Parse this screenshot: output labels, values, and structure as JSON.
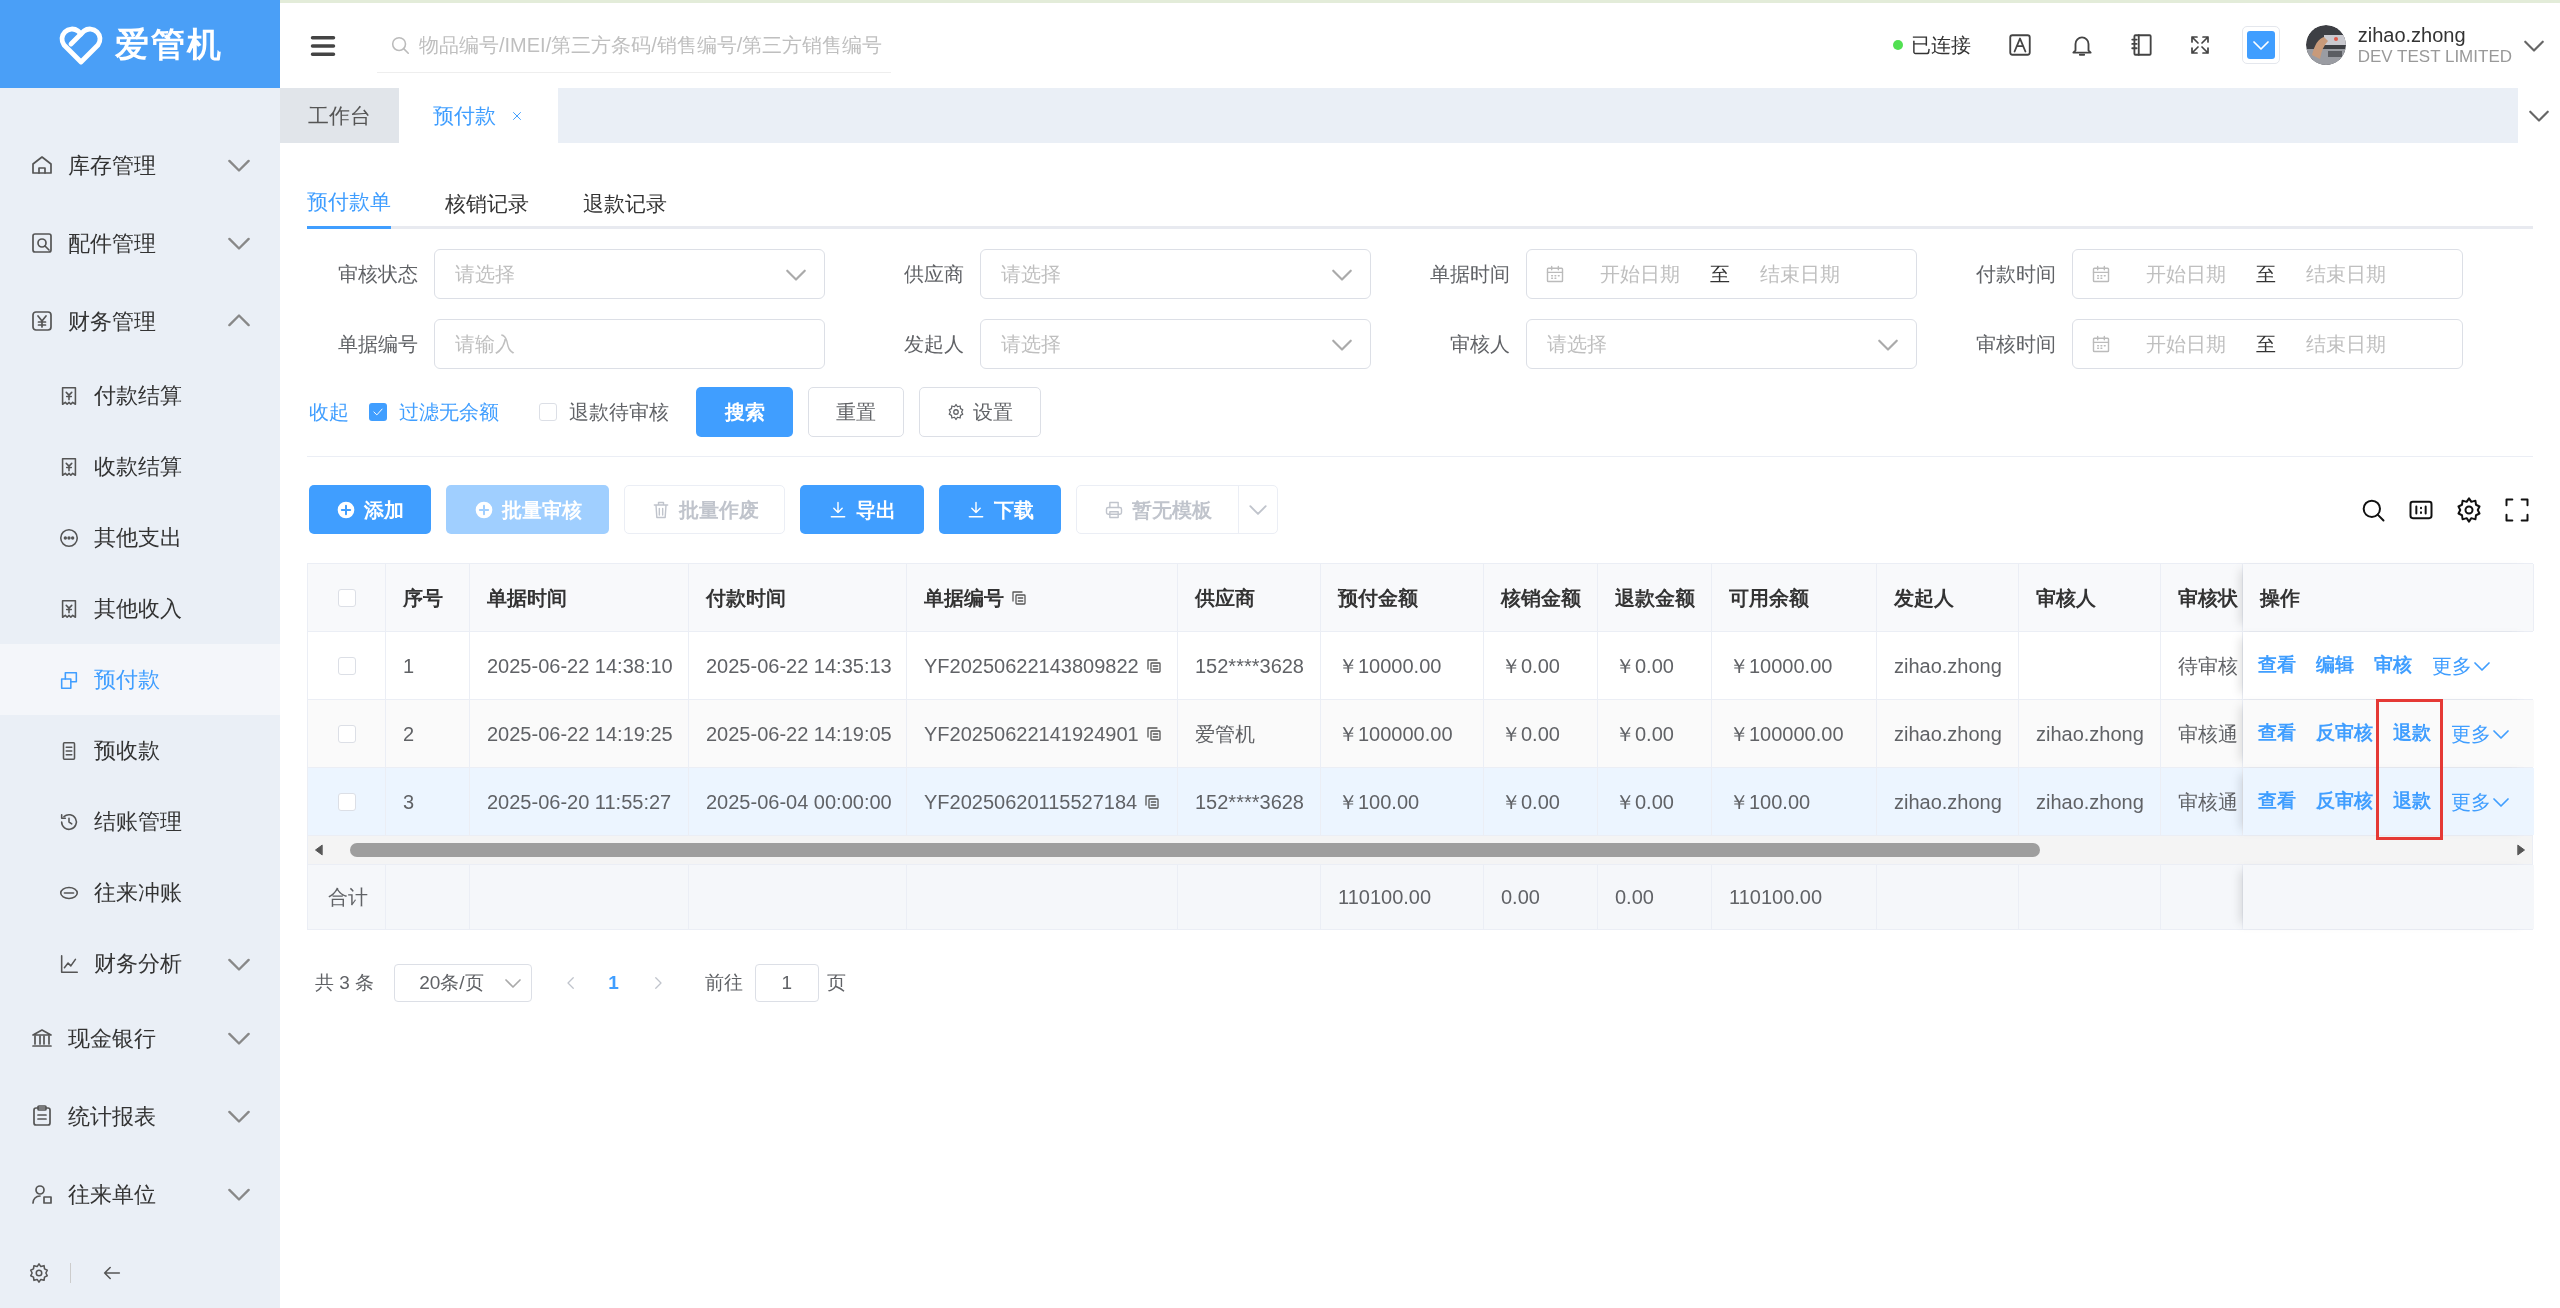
{
  "sidebar": {
    "logo": "爱管机",
    "items": [
      {
        "label": "库存管理",
        "expanded": false
      },
      {
        "label": "配件管理",
        "expanded": false
      },
      {
        "label": "财务管理",
        "expanded": true,
        "children": [
          {
            "label": "付款结算",
            "selected": false
          },
          {
            "label": "收款结算",
            "selected": false
          },
          {
            "label": "其他支出",
            "selected": false
          },
          {
            "label": "其他收入",
            "selected": false
          },
          {
            "label": "预付款",
            "selected": true
          },
          {
            "label": "预收款",
            "selected": false
          },
          {
            "label": "结账管理",
            "selected": false
          },
          {
            "label": "往来冲账",
            "selected": false
          },
          {
            "label": "财务分析",
            "selected": false,
            "expanded": false
          }
        ]
      },
      {
        "label": "现金银行",
        "expanded": false
      },
      {
        "label": "统计报表",
        "expanded": false
      },
      {
        "label": "往来单位",
        "expanded": false
      }
    ]
  },
  "header": {
    "search": {
      "placeholder": "物品编号/IMEI/第三方条码/销售编号/第三方销售编号"
    },
    "connection": {
      "label": "已连接",
      "connected": true
    },
    "user": {
      "name": "zihao.zhong",
      "company": "DEV TEST LIMITED"
    }
  },
  "page_tabs": [
    {
      "label": "工作台",
      "selected": false,
      "closable": false
    },
    {
      "label": "预付款",
      "selected": true,
      "closable": true
    }
  ],
  "tabs": [
    {
      "label": "预付款单",
      "selected": true
    },
    {
      "label": "核销记录",
      "selected": false
    },
    {
      "label": "退款记录",
      "selected": false
    }
  ],
  "filters": [
    {
      "label": "审核状态",
      "kind": "select",
      "placeholder": "请选择"
    },
    {
      "label": "供应商",
      "kind": "select",
      "placeholder": "请选择"
    },
    {
      "label": "单据时间",
      "kind": "daterange",
      "start_placeholder": "开始日期",
      "separator": "至",
      "end_placeholder": "结束日期"
    },
    {
      "label": "付款时间",
      "kind": "daterange",
      "start_placeholder": "开始日期",
      "separator": "至",
      "end_placeholder": "结束日期"
    },
    {
      "label": "单据编号",
      "kind": "input",
      "placeholder": "请输入"
    },
    {
      "label": "发起人",
      "kind": "select",
      "placeholder": "请选择"
    },
    {
      "label": "审核人",
      "kind": "select",
      "placeholder": "请选择"
    },
    {
      "label": "审核时间",
      "kind": "daterange",
      "start_placeholder": "开始日期",
      "separator": "至",
      "end_placeholder": "结束日期"
    }
  ],
  "filter_actions": {
    "collapse_link": "收起",
    "checkboxes": [
      {
        "label": "过滤无余额",
        "checked": true
      },
      {
        "label": "退款待审核",
        "checked": false
      }
    ],
    "buttons": [
      {
        "label": "搜索",
        "kind": "primary"
      },
      {
        "label": "重置",
        "kind": "plain"
      },
      {
        "label": "设置",
        "kind": "settings"
      }
    ]
  },
  "toolbar": [
    {
      "label": "添加",
      "kind": "primary",
      "disabled": false
    },
    {
      "label": "批量审核",
      "kind": "primary",
      "disabled": true
    },
    {
      "label": "批量作废",
      "kind": "plain",
      "disabled": true
    },
    {
      "label": "导出",
      "kind": "primary",
      "disabled": false
    },
    {
      "label": "下载",
      "kind": "primary",
      "disabled": false
    },
    {
      "label": "暂无模板",
      "kind": "split",
      "disabled": true
    }
  ],
  "table": {
    "all_checked": false,
    "columns": [
      {
        "label": "序号"
      },
      {
        "label": "单据时间"
      },
      {
        "label": "付款时间"
      },
      {
        "label": "单据编号",
        "copy": true
      },
      {
        "label": "供应商"
      },
      {
        "label": "预付金额"
      },
      {
        "label": "核销金额"
      },
      {
        "label": "退款金额"
      },
      {
        "label": "可用余额"
      },
      {
        "label": "发起人"
      },
      {
        "label": "审核人"
      },
      {
        "label": "审核状"
      },
      {
        "label": "操作"
      }
    ],
    "rows": [
      {
        "checked": false,
        "hovered": false,
        "no": "1",
        "doc_time": "2025-06-22 14:38:10",
        "pay_time": "2025-06-22 14:35:13",
        "doc_no": "YF20250622143809822",
        "supplier": "152****3628",
        "prepaid": "￥10000.00",
        "written_off": "￥0.00",
        "refunded": "￥0.00",
        "available": "￥10000.00",
        "initiator": "zihao.zhong",
        "status": "待审核",
        "actions": [
          {
            "label": "查看",
            "kind": "link"
          },
          {
            "label": "编辑",
            "kind": "link"
          },
          {
            "label": "审核",
            "kind": "link"
          },
          {
            "label": "更多",
            "kind": "dropdown"
          }
        ]
      },
      {
        "checked": false,
        "hovered": false,
        "no": "2",
        "doc_time": "2025-06-22 14:19:25",
        "pay_time": "2025-06-22 14:19:05",
        "doc_no": "YF20250622141924901",
        "supplier": "爱管机",
        "prepaid": "￥100000.00",
        "written_off": "￥0.00",
        "refunded": "￥0.00",
        "available": "￥100000.00",
        "initiator": "zihao.zhong",
        "reviewer": "zihao.zhong",
        "status": "审核通",
        "actions": [
          {
            "label": "查看",
            "kind": "link"
          },
          {
            "label": "反审核",
            "kind": "link"
          },
          {
            "label": "退款",
            "kind": "link"
          },
          {
            "label": "更多",
            "kind": "dropdown"
          }
        ]
      },
      {
        "checked": false,
        "hovered": true,
        "no": "3",
        "doc_time": "2025-06-20 11:55:27",
        "pay_time": "2025-06-04 00:00:00",
        "doc_no": "YF20250620115527184",
        "supplier": "152****3628",
        "prepaid": "￥100.00",
        "written_off": "￥0.00",
        "refunded": "￥0.00",
        "available": "￥100.00",
        "initiator": "zihao.zhong",
        "reviewer": "zihao.zhong",
        "status": "审核通",
        "actions": [
          {
            "label": "查看",
            "kind": "link"
          },
          {
            "label": "反审核",
            "kind": "link"
          },
          {
            "label": "退款",
            "kind": "link"
          },
          {
            "label": "更多",
            "kind": "dropdown"
          }
        ]
      }
    ],
    "summary": {
      "label": "合计",
      "prepaid": "110100.00",
      "written_off": "0.00",
      "refunded": "0.00",
      "available": "110100.00"
    },
    "annotation_box": true
  },
  "pagination": {
    "total": "共 3 条",
    "page_size": "20条/页",
    "pages": [
      {
        "label": "1",
        "selected": true
      }
    ],
    "goto_label": "前往",
    "goto_value": "1",
    "page_suffix": "页"
  }
}
